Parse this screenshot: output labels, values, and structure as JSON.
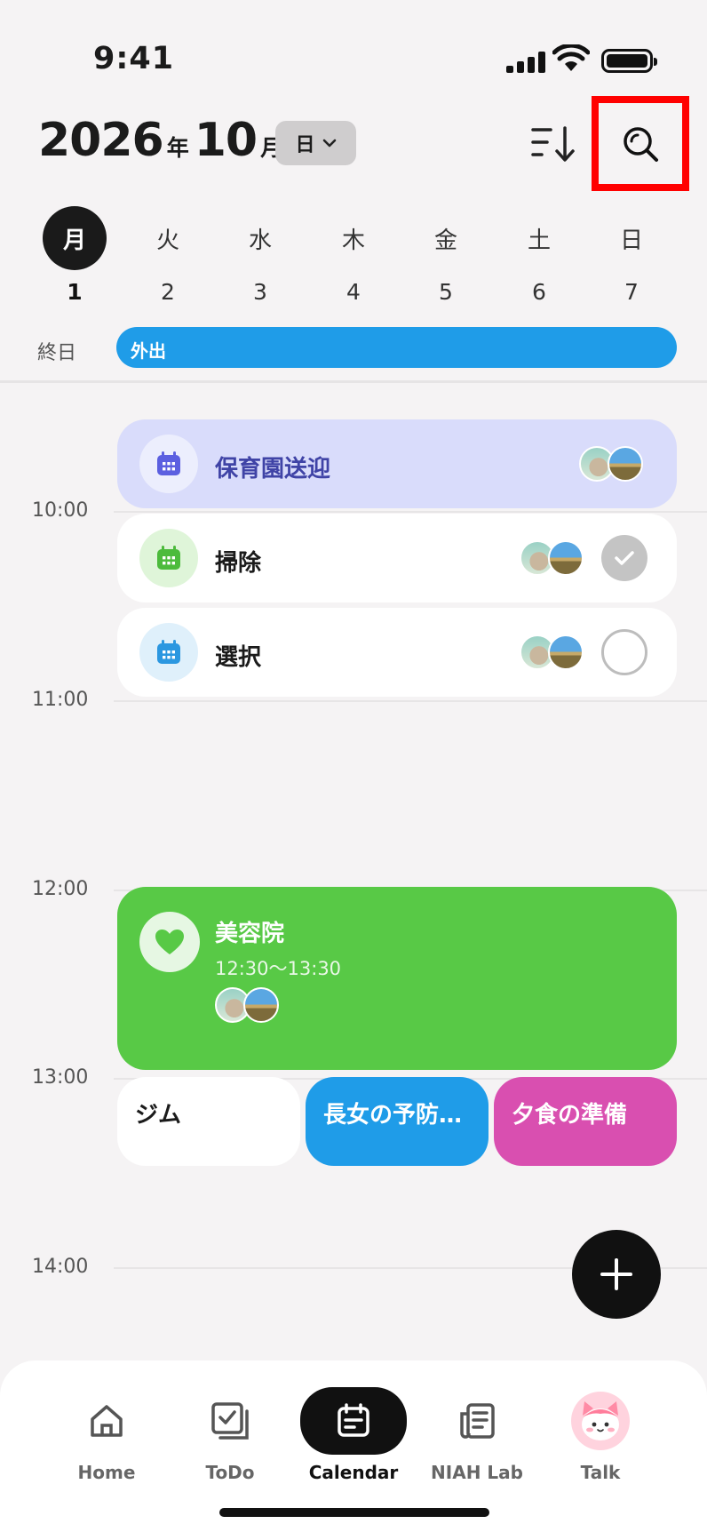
{
  "status_bar": {
    "time": "9:41"
  },
  "header": {
    "year": "2026",
    "year_unit": "年",
    "month": "10",
    "month_unit": "月",
    "view_mode": "日"
  },
  "week": [
    {
      "day": "月",
      "date": "1",
      "active": true
    },
    {
      "day": "火",
      "date": "2"
    },
    {
      "day": "水",
      "date": "3"
    },
    {
      "day": "木",
      "date": "4"
    },
    {
      "day": "金",
      "date": "5"
    },
    {
      "day": "土",
      "date": "6"
    },
    {
      "day": "日",
      "date": "7"
    }
  ],
  "all_day": {
    "label": "終日",
    "event": "外出",
    "color": "#1f9ce8"
  },
  "hours": [
    "10:00",
    "11:00",
    "12:00",
    "13:00",
    "14:00"
  ],
  "events": [
    {
      "title": "保育園送迎",
      "bg": "#d9dcfb",
      "title_color": "#3f43a6",
      "icon_bg": "#eceefd",
      "icon_color": "#5b5fe0",
      "icon": "calendar-icon",
      "check": null
    },
    {
      "title": "掃除",
      "bg": "#ffffff",
      "title_color": "#1b1b1b",
      "icon_bg": "#dff5d9",
      "icon_color": "#4cbb3c",
      "icon": "calendar-icon",
      "check": "done"
    },
    {
      "title": "選択",
      "bg": "#ffffff",
      "title_color": "#1b1b1b",
      "icon_bg": "#dff0fb",
      "icon_color": "#2b97e0",
      "icon": "calendar-icon",
      "check": "empty"
    }
  ],
  "big_event": {
    "title": "美容院",
    "time": "12:30～13:30",
    "bg": "#58c946",
    "icon": "heart-icon"
  },
  "mini_events": [
    {
      "title": "ジム",
      "bg": "#ffffff",
      "color": "#1b1b1b"
    },
    {
      "title": "長女の予防…",
      "bg": "#1f9ce8",
      "color": "#ffffff"
    },
    {
      "title": "夕食の準備",
      "bg": "#d94fb0",
      "color": "#ffffff"
    }
  ],
  "tabs": [
    {
      "label": "Home",
      "icon": "home-icon"
    },
    {
      "label": "ToDo",
      "icon": "todo-icon"
    },
    {
      "label": "Calendar",
      "icon": "calendar-icon",
      "active": true
    },
    {
      "label": "NIAH Lab",
      "icon": "news-icon"
    },
    {
      "label": "Talk",
      "icon": "character-avatar-icon"
    }
  ]
}
